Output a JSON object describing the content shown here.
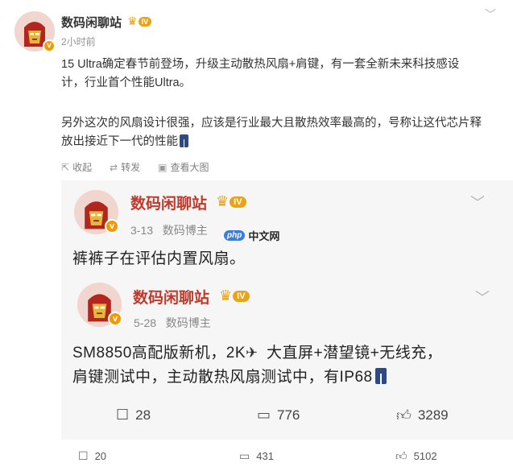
{
  "post": {
    "author": "数码闲聊站",
    "level": "IV",
    "time": "2小时前",
    "paragraph1_line1": "15 Ultra确定春节前登场，升级主动散热风扇+肩键，有一套全新未来科技感设",
    "paragraph1_line2": "计，行业首个性能Ultra。",
    "paragraph2_line1": "另外这次的风扇设计很强，应该是行业最大且散热效率最高的，号称让这代芯片释",
    "paragraph2_line2": "放出接近下一代的性能",
    "actions": {
      "collect": "收起",
      "repost": "转发",
      "view_image": "查看大图"
    },
    "icons": {
      "collect": "collapse-icon",
      "repost": "repost-icon",
      "view_image": "image-icon",
      "jeans": "jeans-emoji-icon"
    }
  },
  "repost_card": {
    "watermark": {
      "logo": "php",
      "text": "中文网"
    },
    "comment1": {
      "author": "数码闲聊站",
      "level": "IV",
      "date": "3-13",
      "role": "数码博主",
      "text": "裤裤子在评估内置风扇。"
    },
    "comment2": {
      "author": "数码闲聊站",
      "level": "IV",
      "date": "5-28",
      "role": "数码博主",
      "line1_a": "SM8850高配版新机，2K",
      "line1_b": "大直屏+潜望镜+无线充，",
      "line2": "肩键测试中，主动散热风扇测试中，有IP68"
    },
    "actions": {
      "repost": "28",
      "comment": "776",
      "like": "3289"
    }
  },
  "bottom_bar": {
    "repost": "20",
    "comment": "431",
    "like": "5102"
  },
  "colors": {
    "accent": "#f39800",
    "crown": "#e8a317",
    "card_bg": "#f6f6f6",
    "muted": "#939393"
  }
}
